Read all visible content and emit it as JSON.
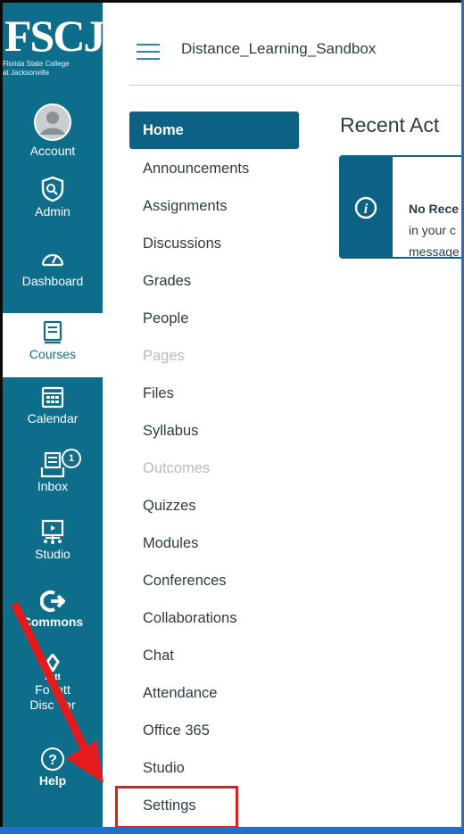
{
  "logo": {
    "initials": "FSCJ",
    "line1": "Florida State College",
    "line2": "at Jacksonville"
  },
  "global_nav": [
    {
      "label": "Account",
      "icon": "account-icon"
    },
    {
      "label": "Admin",
      "icon": "admin-icon"
    },
    {
      "label": "Dashboard",
      "icon": "dashboard-icon"
    },
    {
      "label": "Courses",
      "icon": "courses-icon",
      "active": true
    },
    {
      "label": "Calendar",
      "icon": "calendar-icon"
    },
    {
      "label": "Inbox",
      "icon": "inbox-icon",
      "badge": "1"
    },
    {
      "label": "Studio",
      "icon": "studio-icon"
    },
    {
      "label": "Commons",
      "icon": "commons-icon"
    },
    {
      "label": "Follett Discover",
      "icon": "follett-icon",
      "line1": "llett",
      "line2": "Fo  ett",
      "line3": "Disc   er"
    },
    {
      "label": "Help",
      "icon": "help-icon"
    }
  ],
  "header": {
    "breadcrumb": "Distance_Learning_Sandbox"
  },
  "course_nav": [
    {
      "label": "Home",
      "state": "active"
    },
    {
      "label": "Announcements"
    },
    {
      "label": "Assignments"
    },
    {
      "label": "Discussions"
    },
    {
      "label": "Grades"
    },
    {
      "label": "People"
    },
    {
      "label": "Pages",
      "state": "disabled"
    },
    {
      "label": "Files"
    },
    {
      "label": "Syllabus"
    },
    {
      "label": "Outcomes",
      "state": "disabled"
    },
    {
      "label": "Quizzes"
    },
    {
      "label": "Modules"
    },
    {
      "label": "Conferences"
    },
    {
      "label": "Collaborations"
    },
    {
      "label": "Chat"
    },
    {
      "label": "Attendance"
    },
    {
      "label": "Office 365"
    },
    {
      "label": "Studio"
    },
    {
      "label": "Settings",
      "highlighted": true
    }
  ],
  "main": {
    "title": "Recent Act",
    "alert": {
      "bold": "No Rece",
      "line2": "in your c",
      "line3": "message"
    }
  },
  "colors": {
    "nav_bg": "#0f6d8c",
    "home_bg": "#0b6285",
    "highlight": "#e21b1b",
    "page_bg": "#1f6fd1"
  }
}
